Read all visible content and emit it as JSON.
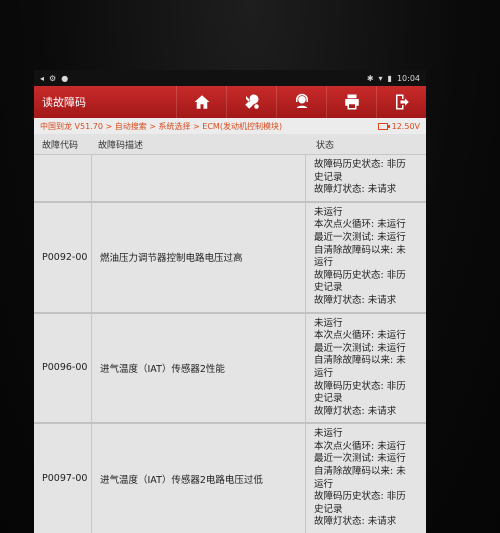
{
  "statusbar": {
    "left_icons": [
      "◂",
      "⚙",
      "●"
    ],
    "right_icons": [
      "✱",
      "▾",
      "▮"
    ],
    "time": "10:04"
  },
  "header": {
    "title": "读故障码",
    "toolbar": [
      "home-icon",
      "diagnose-icon",
      "support-icon",
      "print-icon",
      "exit-icon"
    ]
  },
  "breadcrumb": "中国到龙 V51.70 > 自动搜索 > 系统选择 > ECM(发动机控制模块)",
  "voltage": "12.50V",
  "columns": {
    "code": "故障代码",
    "description": "故障码描述",
    "status": "状态"
  },
  "rows": [
    {
      "code": "",
      "description": "",
      "status": [
        "故障码历史状态: 非历",
        "史记录",
        "故障灯状态: 未请求"
      ]
    },
    {
      "code": "P0092-00",
      "description": "燃油压力调节器控制电路电压过高",
      "status": [
        "未运行",
        "本次点火循环: 未运行",
        "最近一次测试: 未运行",
        "自清除故障码以来: 未",
        "运行",
        "故障码历史状态: 非历",
        "史记录",
        "故障灯状态: 未请求"
      ]
    },
    {
      "code": "P0096-00",
      "description": "进气温度（IAT）传感器2性能",
      "status": [
        "未运行",
        "本次点火循环: 未运行",
        "最近一次测试: 未运行",
        "自清除故障码以来: 未",
        "运行",
        "故障码历史状态: 非历",
        "史记录",
        "故障灯状态: 未请求"
      ]
    },
    {
      "code": "P0097-00",
      "description": "进气温度（IAT）传感器2电路电压过低",
      "status": [
        "未运行",
        "本次点火循环: 未运行",
        "最近一次测试: 未运行",
        "自清除故障码以来: 未",
        "运行",
        "故障码历史状态: 非历",
        "史记录",
        "故障灯状态: 未请求"
      ]
    }
  ]
}
